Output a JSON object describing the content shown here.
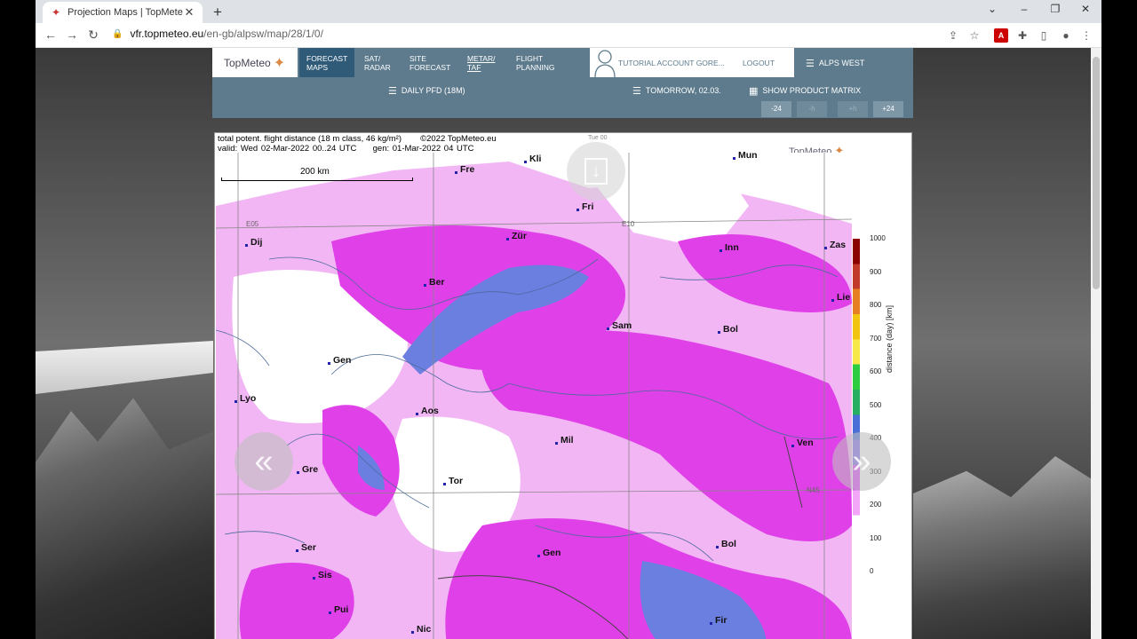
{
  "browser": {
    "tab_title": "Projection Maps | TopMeteo",
    "url_host": "vfr.topmeteo.eu",
    "url_path": "/en-gb/alpsw/map/28/1/0/"
  },
  "header": {
    "logo": "TopMeteo",
    "nav": [
      {
        "label": "FORECAST\nMAPS",
        "active": true
      },
      {
        "label": "SAT/\nRADAR"
      },
      {
        "label": "SITE\nFORECAST"
      },
      {
        "label": "METAR/\nTAF"
      },
      {
        "label": "FLIGHT\nPLANNING"
      }
    ],
    "user": "TUTORIAL ACCOUNT GORE...",
    "logout": "LOGOUT",
    "region": "ALPS WEST"
  },
  "subheader": {
    "product": "DAILY PFD (18M)",
    "date": "TOMORROW, 02.03.",
    "matrix": "SHOW PRODUCT MATRIX",
    "steps": [
      "-24",
      "-h",
      "+h",
      "+24"
    ]
  },
  "map": {
    "title_line1": "total potent. flight distance (18 m class, 46 kg/m²)",
    "copyright": "©2022 TopMeteo.eu",
    "valid": "valid:  Wed   02-Mar-2022  00..24 UTC",
    "gen": "gen:  01-Mar-2022  04 UTC",
    "timer": "Tue 00",
    "logo": "TopMeteo",
    "scale": "200 km",
    "grid_labels": [
      "E05",
      "E10",
      "N45"
    ],
    "cities": [
      "Fre",
      "Kli",
      "Mun",
      "Fri",
      "Dij",
      "Zür",
      "Inn",
      "Zas",
      "Ber",
      "Lie",
      "Sam",
      "Bol",
      "Gen",
      "Lyo",
      "Aos",
      "Mil",
      "Ven",
      "Gre",
      "Tor",
      "Ser",
      "Gen",
      "Bol",
      "Sis",
      "Pui",
      "Fir",
      "Nic"
    ],
    "colorbar": {
      "labels": [
        "1000",
        "900",
        "800",
        "700",
        "600",
        "500",
        "400",
        "300",
        "200",
        "100",
        "0"
      ],
      "axis_label": "distance (day) [km]",
      "colors": [
        "#8b0000",
        "#c0392b",
        "#e67e22",
        "#f1c40f",
        "#f7e84a",
        "#2ecc40",
        "#27ae60",
        "#4a6fd6",
        "#7b68ee",
        "#e040fb",
        "#f3a6f7",
        "#ffffff"
      ]
    }
  }
}
